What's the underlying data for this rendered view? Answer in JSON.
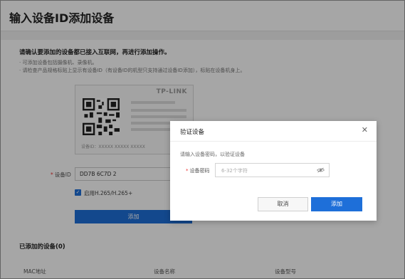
{
  "page": {
    "title": "输入设备ID添加设备",
    "notice": "请确认要添加的设备都已接入互联网，再进行添加操作。",
    "hints": [
      "· 可添加设备包括摄像机、录像机。",
      "· 请检查产品规格标贴上显示有设备ID（有设备ID的机型只支持通过设备ID添加），标贴在设备机身上。"
    ],
    "card": {
      "brand": "TP-LINK",
      "device_id_text": "设备ID：XXXXX XXXXX XXXXX"
    },
    "form": {
      "device_id_label": "设备ID",
      "device_id_value": "DD7B 6C7D 2",
      "h265_label": "启用H.265/H.265+",
      "h265_checked": true,
      "add_button": "添加"
    },
    "added_devices": {
      "title": "已添加的设备(0)",
      "columns": [
        "MAC地址",
        "设备名称",
        "设备型号"
      ]
    }
  },
  "dialog": {
    "title": "验证设备",
    "close_icon": "close-icon",
    "description": "请输入设备密码，以验证设备",
    "password_label": "设备密码",
    "password_placeholder": "6-32个字符",
    "eye_icon": "eye-off-icon",
    "cancel_button": "取消",
    "add_button": "添加"
  },
  "colors": {
    "primary": "#1e6fd9",
    "required": "#ee3333"
  }
}
